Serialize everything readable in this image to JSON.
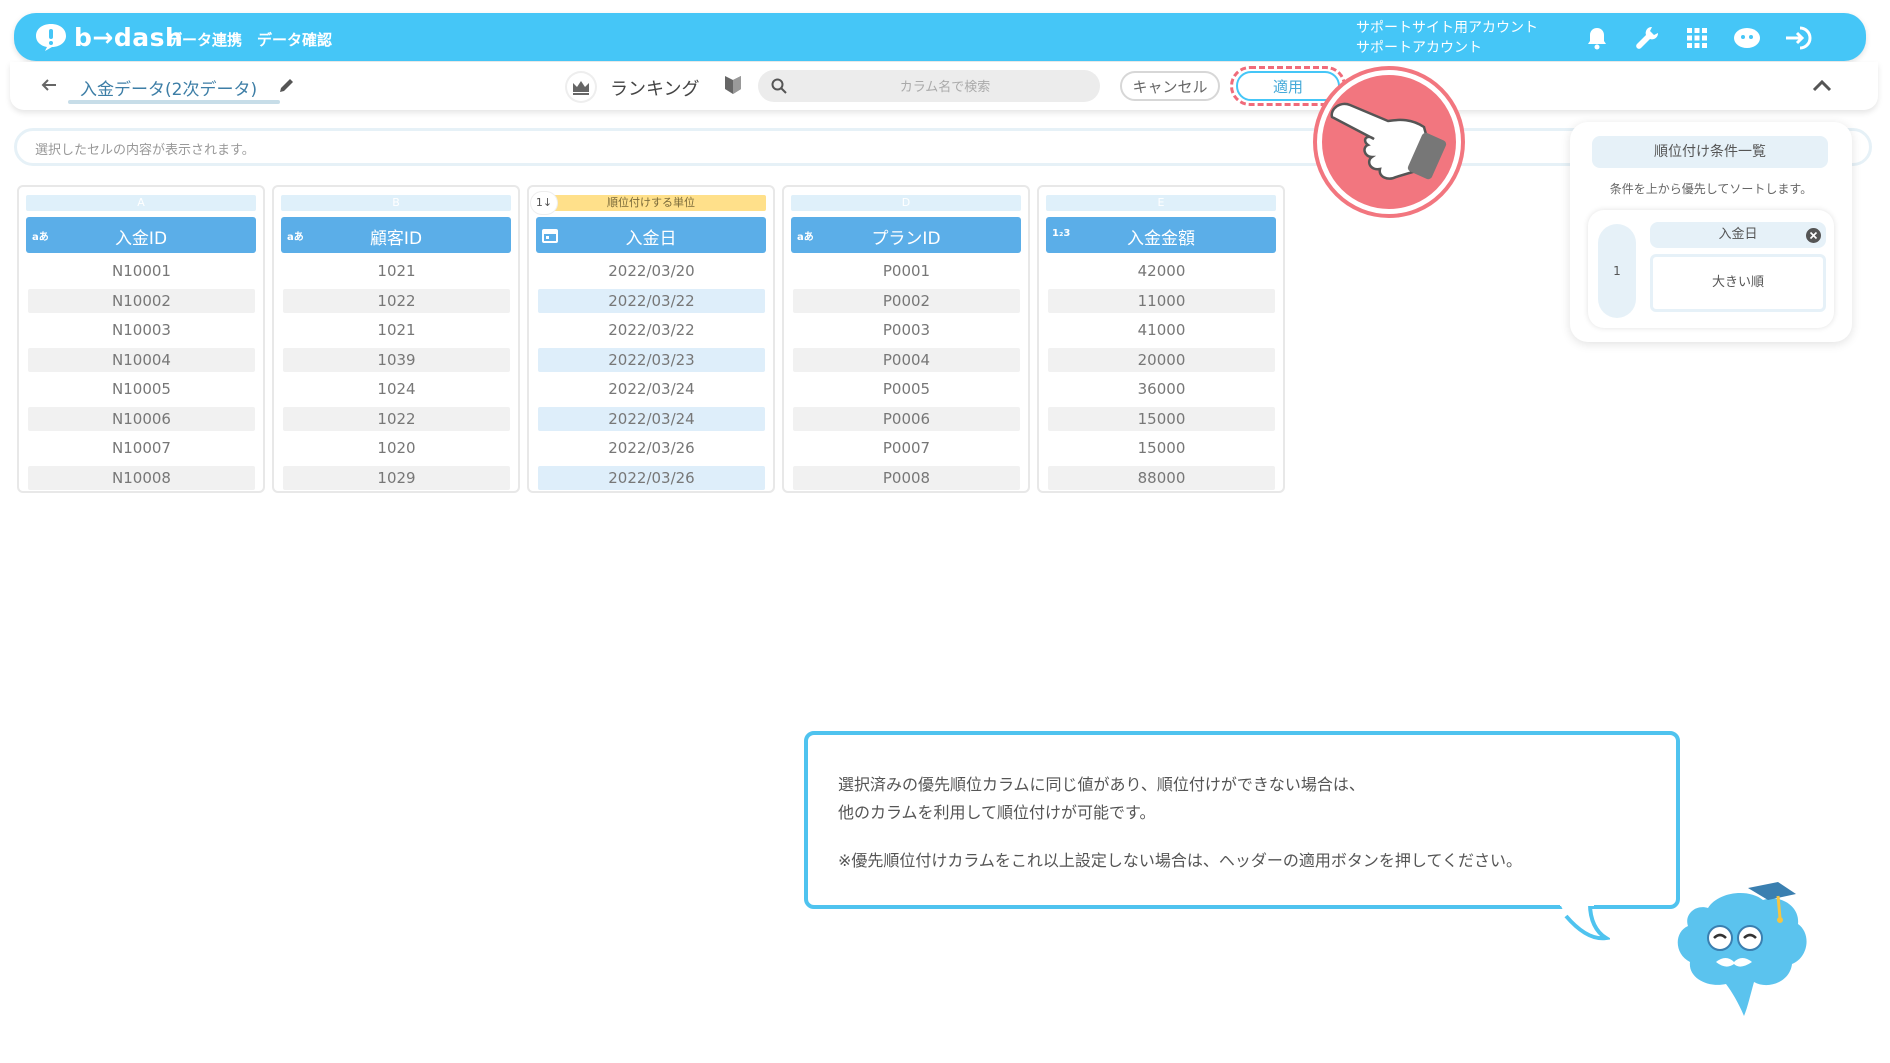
{
  "header": {
    "logo_text": "b→dash",
    "nav": [
      "データ連携",
      "データ確認"
    ],
    "account_line1": "サポートサイト用アカウント",
    "account_line2": "サポートアカウント",
    "icons": [
      "bell-icon",
      "wrench-icon",
      "grid-icon",
      "support-icon",
      "logout-icon"
    ],
    "color": "#45c6f7"
  },
  "subbar": {
    "title": "入金データ(2次データ)",
    "mode_label": "ランキング",
    "search_placeholder": "カラム名で検索",
    "cancel_label": "キャンセル",
    "apply_label": "適用"
  },
  "cellbar": {
    "placeholder": "選択したセルの内容が表示されます。"
  },
  "columns": [
    {
      "letter": "A",
      "type": "aあ",
      "name": "入金ID",
      "rows": [
        "N10001",
        "N10002",
        "N10003",
        "N10004",
        "N10005",
        "N10006",
        "N10007",
        "N10008"
      ]
    },
    {
      "letter": "B",
      "type": "aあ",
      "name": "顧客ID",
      "rows": [
        "1021",
        "1022",
        "1021",
        "1039",
        "1024",
        "1022",
        "1020",
        "1029"
      ]
    },
    {
      "letter": "順位付けする単位",
      "rank": "1↓",
      "type": "cal",
      "name": "入金日",
      "rows": [
        "2022/03/20",
        "2022/03/22",
        "2022/03/22",
        "2022/03/23",
        "2022/03/24",
        "2022/03/24",
        "2022/03/26",
        "2022/03/26"
      ]
    },
    {
      "letter": "D",
      "type": "aあ",
      "name": "プランID",
      "rows": [
        "P0001",
        "P0002",
        "P0003",
        "P0004",
        "P0005",
        "P0006",
        "P0007",
        "P0008"
      ]
    },
    {
      "letter": "E",
      "type": "1₂3",
      "name": "入金金額",
      "rows": [
        "42000",
        "11000",
        "41000",
        "20000",
        "36000",
        "15000",
        "15000",
        "88000"
      ]
    }
  ],
  "panel": {
    "title": "順位付け条件一覧",
    "subtitle": "条件を上から優先してソートします。",
    "conditions": [
      {
        "num": "1",
        "column": "入金日",
        "order": "大きい順"
      }
    ]
  },
  "speech": {
    "line1": "選択済みの優先順位カラムに同じ値があり、順位付けができない場合は、",
    "line2": "他のカラムを利用して順位付けが可能です。",
    "line3": "※優先順位付けカラムをこれ以上設定しない場合は、ヘッダーの適用ボタンを押してください。"
  }
}
